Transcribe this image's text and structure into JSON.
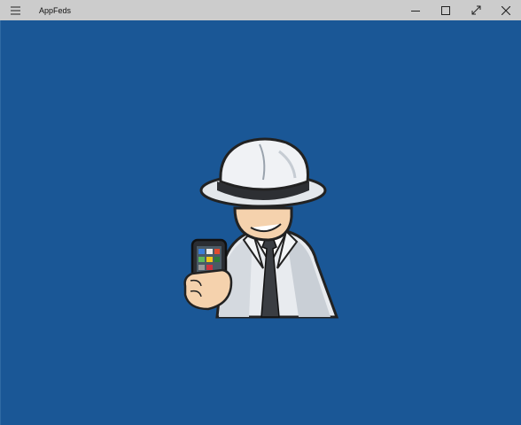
{
  "window": {
    "title": "AppFeds",
    "background_color": "#1a5796"
  },
  "titlebar": {
    "menu_icon": "hamburger-menu-icon",
    "controls": [
      "minimize-icon",
      "restore-icon",
      "fullscreen-icon",
      "close-icon"
    ]
  },
  "splash": {
    "image": "spy-with-phone-logo"
  }
}
